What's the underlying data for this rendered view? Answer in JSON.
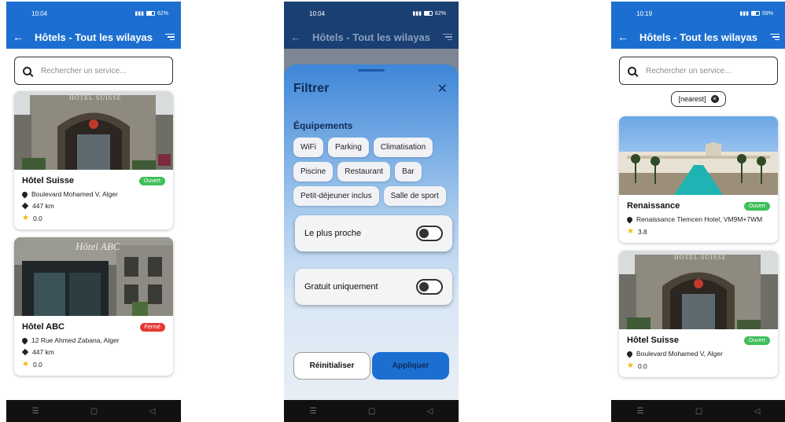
{
  "app": {
    "title": "Hôtels - Tout les wilayas",
    "search_placeholder": "Rechercher un service...",
    "accent_color": "#1c6fd1"
  },
  "screens": [
    {
      "status_time": "10:04",
      "status_right": "62%",
      "cards": [
        {
          "name": "Hôtel Suisse",
          "badge": "Ouvert",
          "address": "Boulevard Mohamed V, Alger",
          "distance": "447 km",
          "rating": "0.0",
          "photo_sign": "HOTEL SUISSE"
        },
        {
          "name": "Hôtel ABC",
          "badge": "Fermé",
          "address": "12 Rue Ahmed Zabana, Alger",
          "distance": "447 km",
          "rating": "0.0",
          "photo_sign": "Hôtel ABC"
        }
      ]
    },
    {
      "status_time": "10:04",
      "status_right": "62%",
      "filter": {
        "title": "Filtrer",
        "section": "Équipements",
        "chips": [
          "WiFi",
          "Parking",
          "Climatisation",
          "Piscine",
          "Restaurant",
          "Bar",
          "Petit-déjeuner inclus",
          "Salle de sport"
        ],
        "toggle_nearest": "Le plus proche",
        "toggle_free": "Gratuit uniquement",
        "reset": "Réinitialiser",
        "apply": "Appliquer"
      }
    },
    {
      "status_time": "10:19",
      "status_right": "59%",
      "active_tag": "[nearest]",
      "cards": [
        {
          "name": "Renaissance",
          "badge": "Ouvert",
          "address": "Renaissance Tlemcen Hotel, VM9M+7WM",
          "rating": "3.8"
        },
        {
          "name": "Hôtel Suisse",
          "badge": "Ouvert",
          "address": "Boulevard Mohamed V, Alger",
          "rating": "0.0",
          "photo_sign": "HOTEL SUISSE"
        }
      ]
    }
  ]
}
